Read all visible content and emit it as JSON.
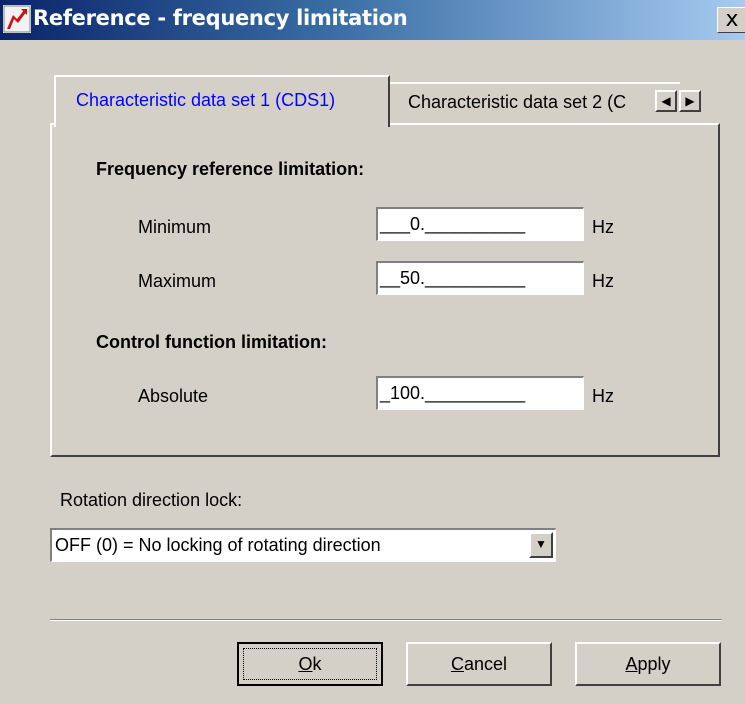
{
  "window": {
    "title": "Reference - frequency limitation",
    "close_label": "x"
  },
  "tabs": {
    "active_label": "Characteristic data set 1 (CDS1)",
    "inactive_label": "Characteristic data set 2 (C",
    "scroll_left": "◀",
    "scroll_right": "▶"
  },
  "frequency_section": {
    "heading": "Frequency reference limitation:",
    "minimum": {
      "label": "Minimum",
      "value": "___0.__________",
      "unit": "Hz"
    },
    "maximum": {
      "label": "Maximum",
      "value": "__50.__________",
      "unit": "Hz"
    }
  },
  "control_section": {
    "heading": "Control function limitation:",
    "absolute": {
      "label": "Absolute",
      "value": "_100.__________",
      "unit": "Hz"
    }
  },
  "rotation": {
    "label": "Rotation direction lock:",
    "selected": "OFF (0) = No locking of rotating direction",
    "dropdown_glyph": "▼"
  },
  "buttons": {
    "ok": {
      "mnemonic": "O",
      "rest": "k"
    },
    "cancel": {
      "mnemonic": "C",
      "rest": "ancel"
    },
    "apply": {
      "mnemonic": "A",
      "rest": "pply"
    }
  }
}
